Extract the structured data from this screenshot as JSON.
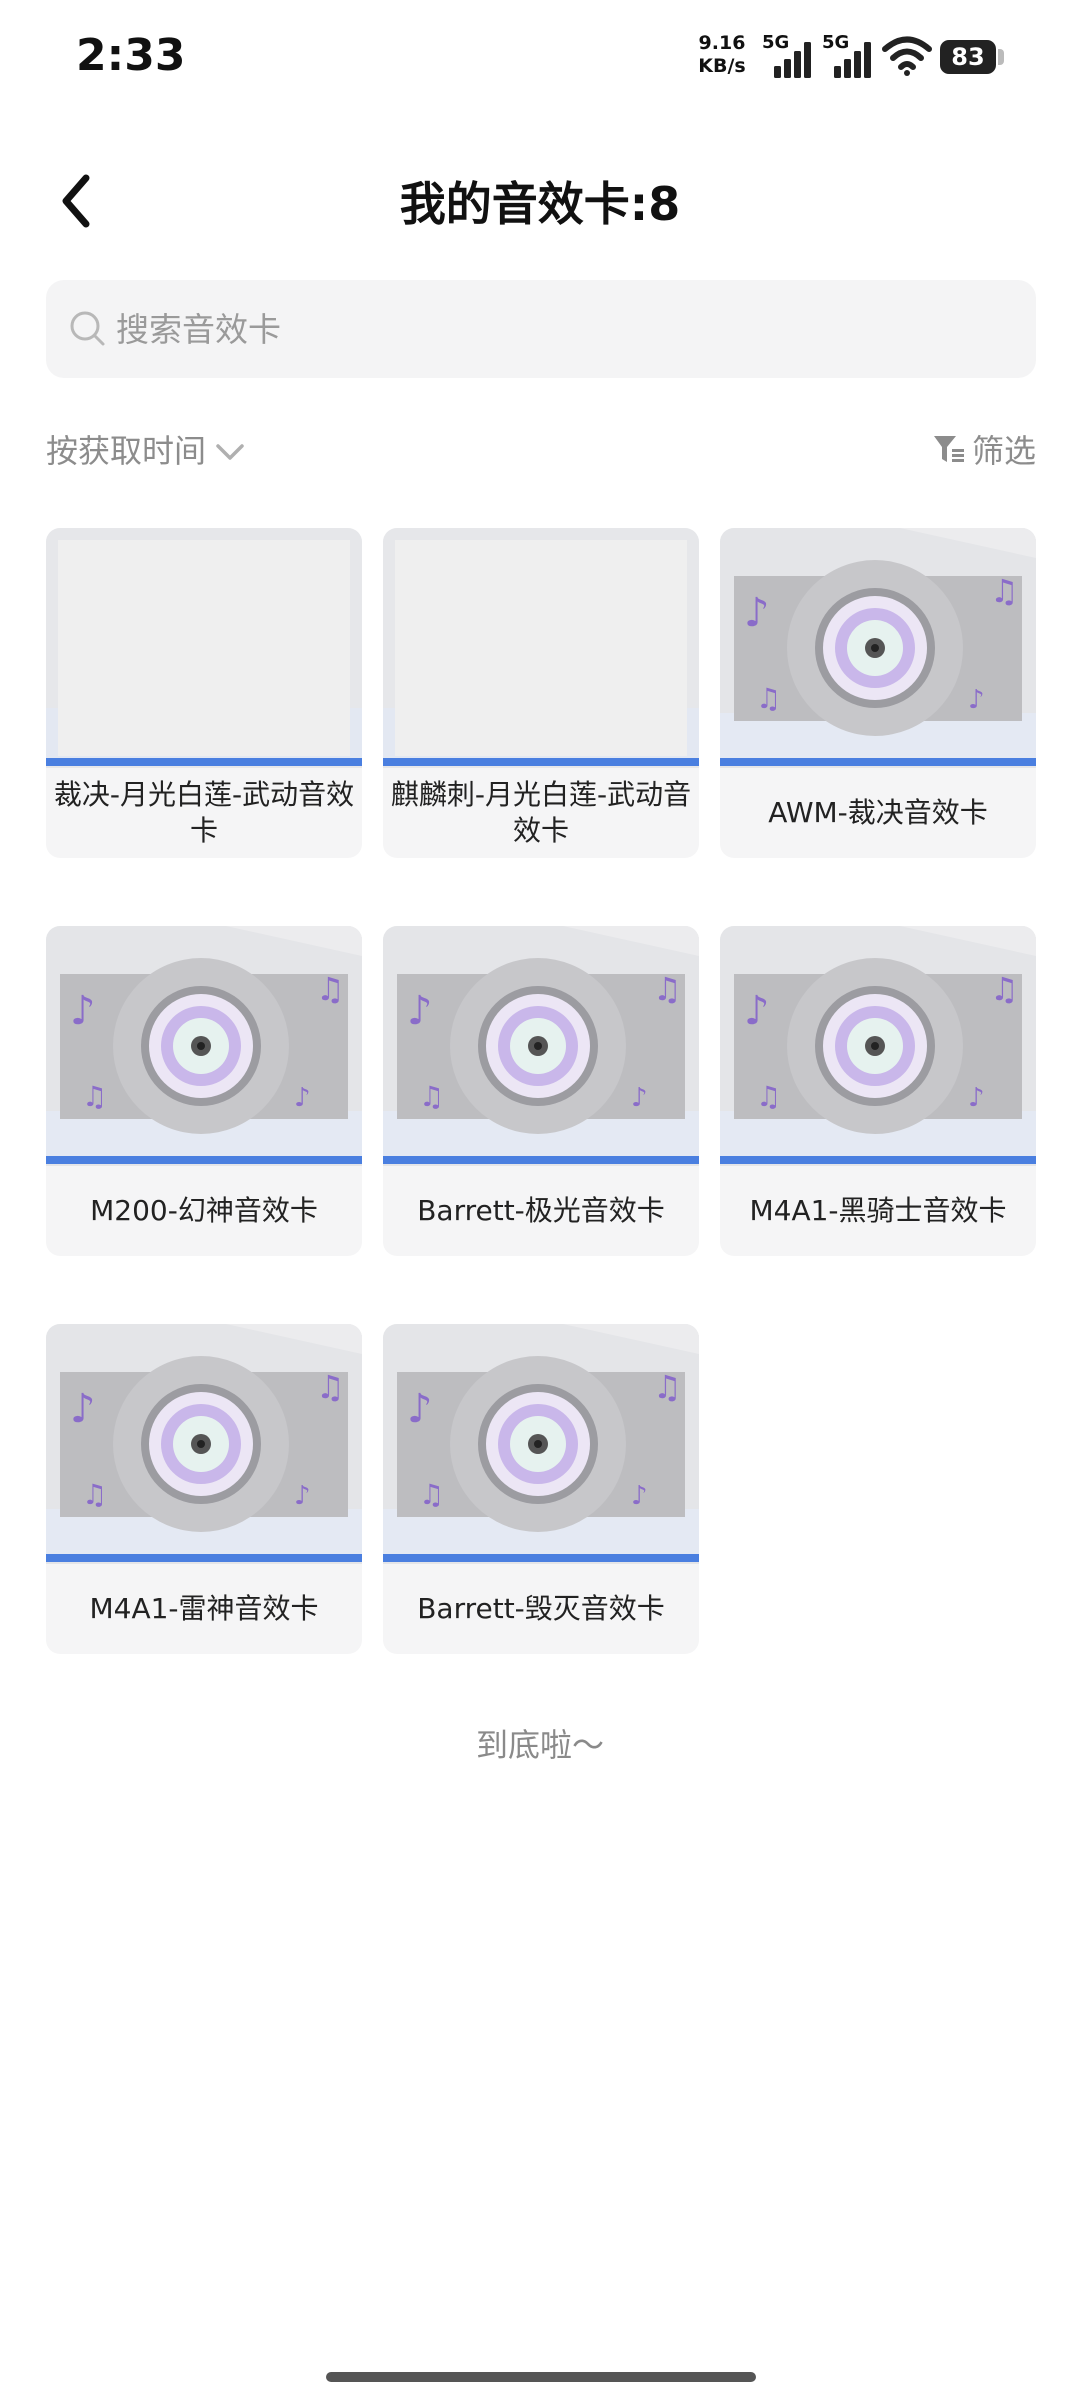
{
  "status_bar": {
    "time": "2:33",
    "net_speed_value": "9.16",
    "net_speed_unit": "KB/s",
    "sim1_tag": "5G",
    "sim2_tag": "5G",
    "battery": "83"
  },
  "header": {
    "title": "我的音效卡:8"
  },
  "search": {
    "placeholder": "搜索音效卡"
  },
  "sort": {
    "label": "按获取时间"
  },
  "filter": {
    "label": "筛选"
  },
  "cards": [
    {
      "name": "裁决-月光白莲-武动音效卡",
      "image": "blank-card-image"
    },
    {
      "name": "麒麟刺-月光白莲-武动音效卡",
      "image": "blank-card-image"
    },
    {
      "name": "AWM-裁决音效卡",
      "image": "vinyl-disc-image"
    },
    {
      "name": "M200-幻神音效卡",
      "image": "vinyl-disc-image"
    },
    {
      "name": "Barrett-极光音效卡",
      "image": "vinyl-disc-image"
    },
    {
      "name": "M4A1-黑骑士音效卡",
      "image": "vinyl-disc-image"
    },
    {
      "name": "M4A1-雷神音效卡",
      "image": "vinyl-disc-image"
    },
    {
      "name": "Barrett-毁灭音效卡",
      "image": "vinyl-disc-image"
    }
  ],
  "footer": {
    "end_text": "到底啦～"
  },
  "colors": {
    "accent_bar": "#4a7fe0",
    "card_bg": "#f5f5f6",
    "disc_purple": "#9b85d8"
  }
}
